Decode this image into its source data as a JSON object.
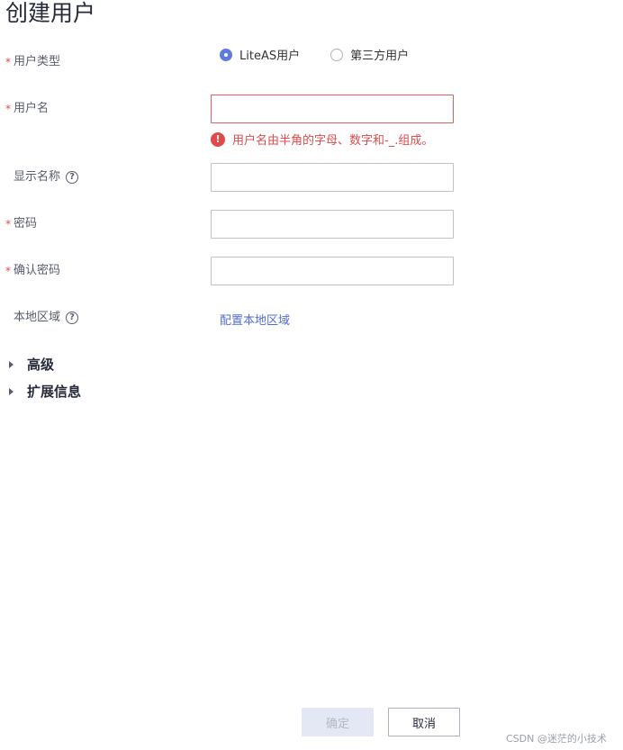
{
  "page": {
    "title": "创建用户"
  },
  "form": {
    "user_type": {
      "label": "用户类型",
      "required_mark": "*",
      "options": [
        {
          "label": "LiteAS用户",
          "selected": true
        },
        {
          "label": "第三方用户",
          "selected": false
        }
      ]
    },
    "username": {
      "label": "用户名",
      "required_mark": "*",
      "value": "",
      "error_message": "用户名由半角的字母、数字和-_.组成。",
      "error_icon": "!"
    },
    "display_name": {
      "label": "显示名称",
      "help_icon": "?",
      "value": ""
    },
    "password": {
      "label": "密码",
      "required_mark": "*",
      "value": ""
    },
    "confirm_password": {
      "label": "确认密码",
      "required_mark": "*",
      "value": ""
    },
    "local_region": {
      "label": "本地区域",
      "help_icon": "?",
      "link_text": "配置本地区域"
    }
  },
  "sections": [
    {
      "label": "高级",
      "expanded": false
    },
    {
      "label": "扩展信息",
      "expanded": false
    }
  ],
  "footer": {
    "confirm_label": "确定",
    "cancel_label": "取消",
    "confirm_disabled": true
  },
  "watermark": "CSDN @迷茫的小技术",
  "colors": {
    "accent": "#5e7ce0",
    "error": "#e04a4a",
    "link": "#526ecc",
    "disabled_button_bg": "#e4e8f4"
  }
}
